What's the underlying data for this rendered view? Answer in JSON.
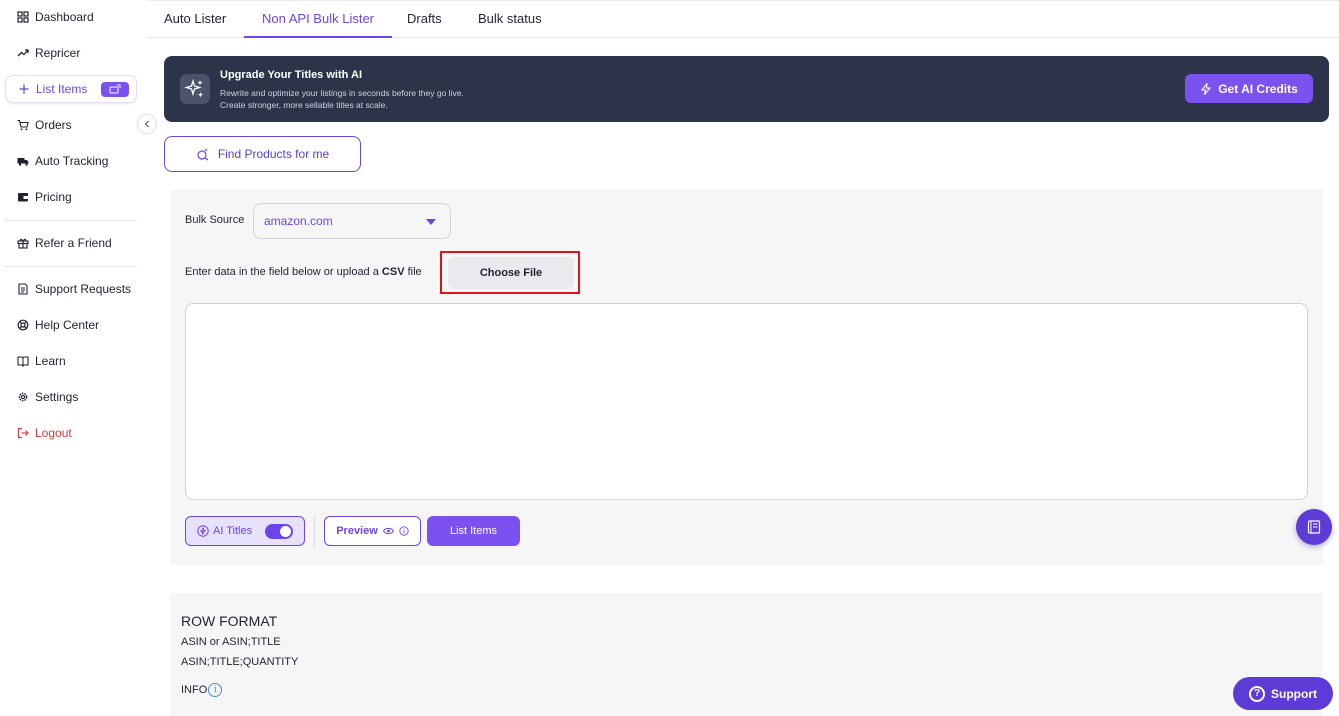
{
  "sidebar": {
    "items": [
      {
        "label": "Dashboard",
        "icon": "grid-icon"
      },
      {
        "label": "Repricer",
        "icon": "trend-icon"
      },
      {
        "label": "List Items",
        "icon": "plus-icon"
      },
      {
        "label": "Orders",
        "icon": "cart-icon"
      },
      {
        "label": "Auto Tracking",
        "icon": "truck-icon"
      },
      {
        "label": "Pricing",
        "icon": "wallet-icon"
      },
      {
        "label": "Refer a Friend",
        "icon": "gift-icon"
      },
      {
        "label": "Support Requests",
        "icon": "document-icon"
      },
      {
        "label": "Help Center",
        "icon": "lifebuoy-icon"
      },
      {
        "label": "Learn",
        "icon": "book-icon"
      },
      {
        "label": "Settings",
        "icon": "gear-icon"
      },
      {
        "label": "Logout",
        "icon": "logout-icon"
      }
    ]
  },
  "tabs": [
    "Auto Lister",
    "Non API Bulk Lister",
    "Drafts",
    "Bulk status"
  ],
  "banner": {
    "title": "Upgrade Your Titles with AI",
    "line1": "Rewrite and optimize your listings in seconds before they go live.",
    "line2": "Create stronger, more sellable titles at scale.",
    "button": "Get AI Credits"
  },
  "find_products": "Find Products for me",
  "bulk": {
    "source_label": "Bulk Source",
    "source_value": "amazon.com",
    "enter_prefix": "Enter data in the field below or upload a",
    "enter_bold": "CSV",
    "enter_suffix": "file",
    "choose_file": "Choose File",
    "data_value": ""
  },
  "actions": {
    "ai_titles": "AI Titles",
    "ai_titles_on": true,
    "preview": "Preview",
    "list_items": "List Items"
  },
  "row_format": {
    "title": "ROW FORMAT",
    "line1": "ASIN or ASIN;TITLE",
    "line2": "ASIN;TITLE;QUANTITY",
    "info": "INFO",
    "info_icon": "i"
  },
  "support": "Support",
  "colors": {
    "accent": "#6b45e8",
    "banner_bg": "#2b3448",
    "highlight": "#e0121c",
    "logout": "#d63b3b"
  }
}
